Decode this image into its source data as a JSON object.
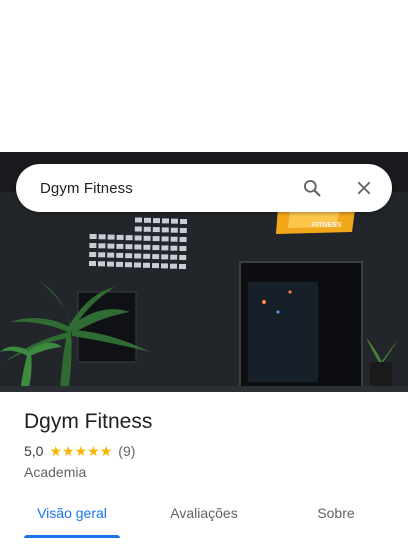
{
  "search": {
    "query": "Dgym Fitness"
  },
  "place": {
    "name": "Dgym Fitness",
    "rating": "5,0",
    "stars": 5,
    "review_count": "(9)",
    "category": "Academia"
  },
  "hero": {
    "sign_text": "FITNESS"
  },
  "tabs": [
    {
      "label": "Visão geral",
      "active": true
    },
    {
      "label": "Avaliações",
      "active": false
    },
    {
      "label": "Sobre",
      "active": false
    }
  ],
  "colors": {
    "accent": "#1a73e8",
    "star": "#f4b400"
  }
}
